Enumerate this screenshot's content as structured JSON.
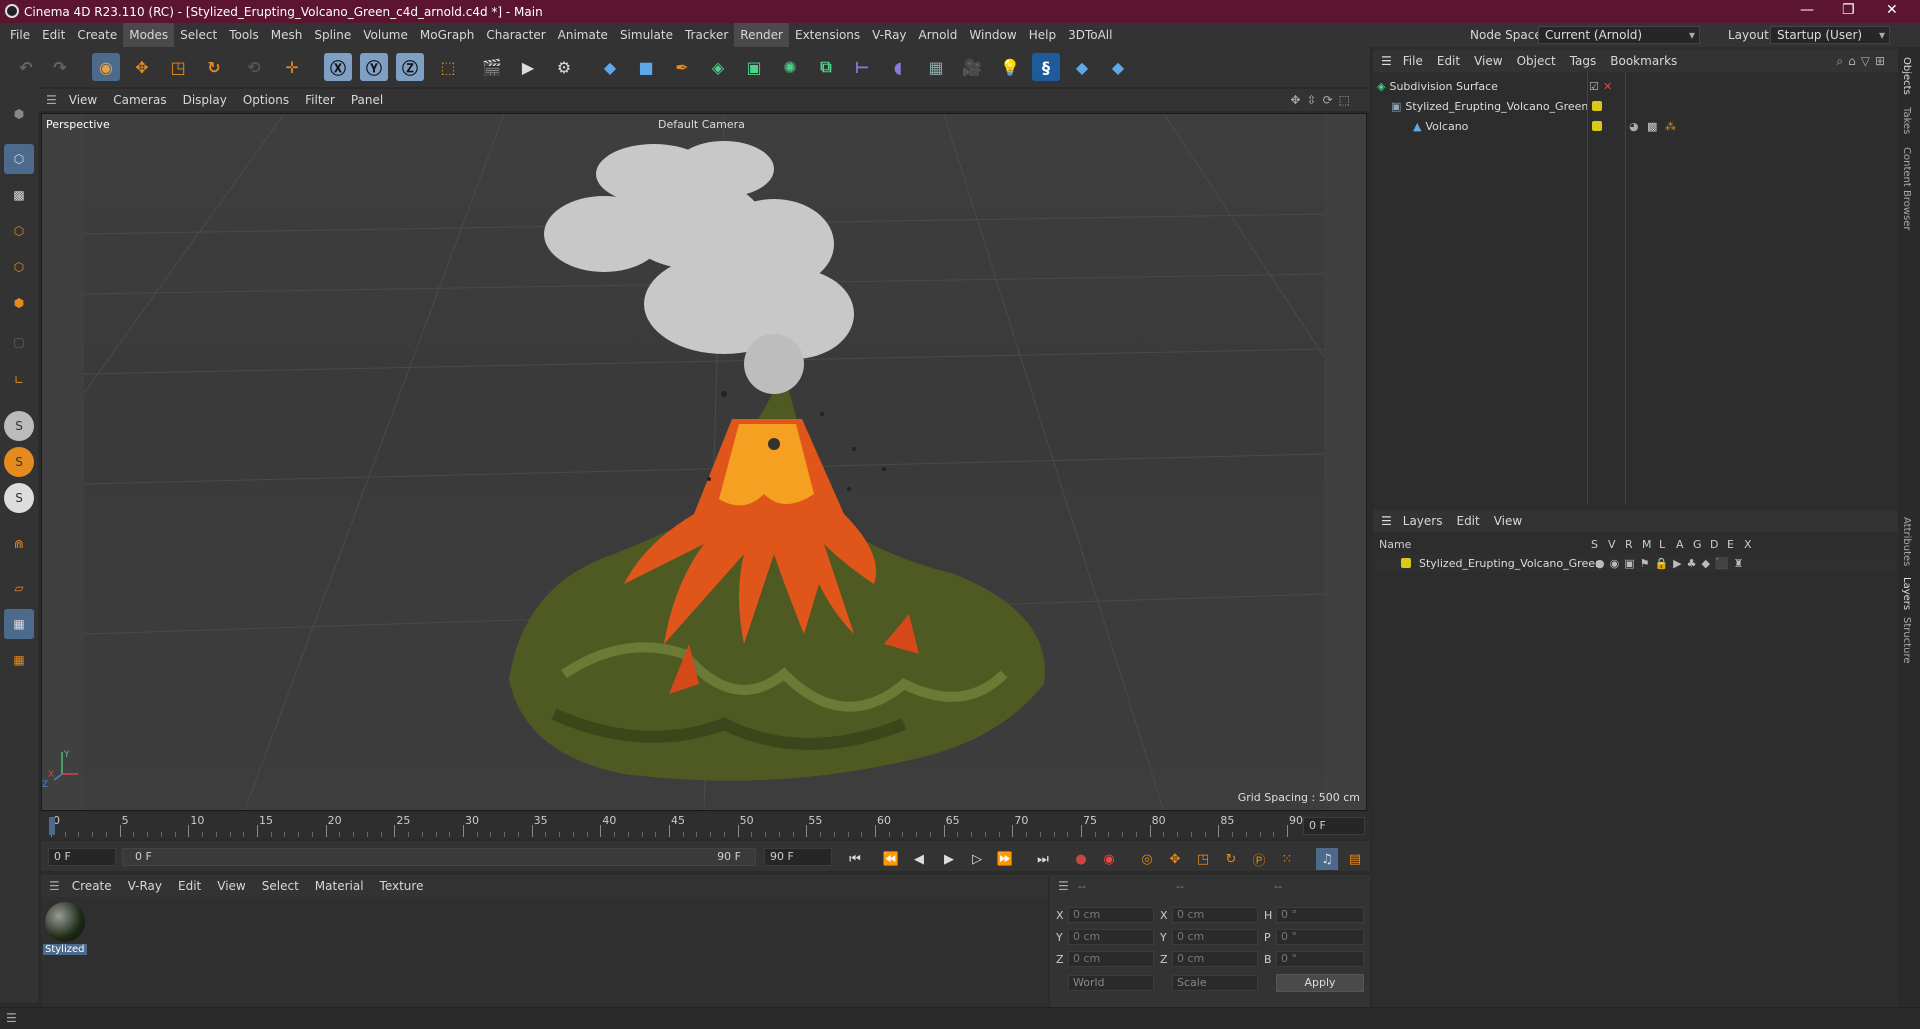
{
  "window": {
    "title": "Cinema 4D R23.110 (RC) - [Stylized_Erupting_Volcano_Green_c4d_arnold.c4d *] - Main"
  },
  "menubar": {
    "items": [
      "File",
      "Edit",
      "Create",
      "Modes",
      "Select",
      "Tools",
      "Mesh",
      "Spline",
      "Volume",
      "MoGraph",
      "Character",
      "Animate",
      "Simulate",
      "Tracker",
      "Render",
      "Extensions",
      "V-Ray",
      "Arnold",
      "Window",
      "Help",
      "3DToAll"
    ],
    "node_space_label": "Node Space:",
    "node_space_value": "Current (Arnold)",
    "layout_label": "Layout:",
    "layout_value": "Startup (User)"
  },
  "viewport": {
    "menu": [
      "View",
      "Cameras",
      "Display",
      "Options",
      "Filter",
      "Panel"
    ],
    "view_name": "Perspective",
    "camera": "Default Camera",
    "grid_spacing": "Grid Spacing : 500 cm",
    "axis_x": "X",
    "axis_y": "Y",
    "axis_z": "Z"
  },
  "timeline": {
    "ticks": [
      "0",
      "5",
      "10",
      "15",
      "20",
      "25",
      "30",
      "35",
      "40",
      "45",
      "50",
      "55",
      "60",
      "65",
      "70",
      "75",
      "80",
      "85",
      "90"
    ],
    "end_field": "0 F"
  },
  "transport": {
    "current_frame": "0 F",
    "range_start": "0 F",
    "range_end": "90 F",
    "max_frame": "90 F"
  },
  "material_panel": {
    "menu": [
      "Create",
      "V-Ray",
      "Edit",
      "View",
      "Select",
      "Material",
      "Texture"
    ],
    "material_name": "Stylized"
  },
  "coords": {
    "headers": [
      "--",
      "--",
      "--"
    ],
    "pos_x": "0 cm",
    "pos_y": "0 cm",
    "pos_z": "0 cm",
    "size_x": "0 cm",
    "size_y": "0 cm",
    "size_z": "0 cm",
    "rot_h": "0 °",
    "rot_p": "0 °",
    "rot_b": "0 °",
    "labels": {
      "x": "X",
      "y": "Y",
      "z": "Z",
      "h": "H",
      "p": "P",
      "b": "B"
    },
    "mode1": "World",
    "mode2": "Scale",
    "apply": "Apply"
  },
  "objects_panel": {
    "menu": [
      "File",
      "Edit",
      "View",
      "Object",
      "Tags",
      "Bookmarks"
    ],
    "items": [
      {
        "name": "Subdivision Surface"
      },
      {
        "name": "Stylized_Erupting_Volcano_Green"
      },
      {
        "name": "Volcano"
      }
    ]
  },
  "layers_panel": {
    "menu": [
      "Layers",
      "Edit",
      "View"
    ],
    "col_name": "Name",
    "cols": [
      "S",
      "V",
      "R",
      "M",
      "L",
      "A",
      "G",
      "D",
      "E",
      "X"
    ],
    "layer_name": "Stylized_Erupting_Volcano_Green"
  },
  "side_tabs": [
    "Objects",
    "Takes",
    "Content Browser",
    "Attributes",
    "Layers",
    "Structure"
  ],
  "colors": {
    "title_bg": "#5b1530",
    "accent_orange": "#e58a1f",
    "layer_yellow": "#d8c81a"
  }
}
